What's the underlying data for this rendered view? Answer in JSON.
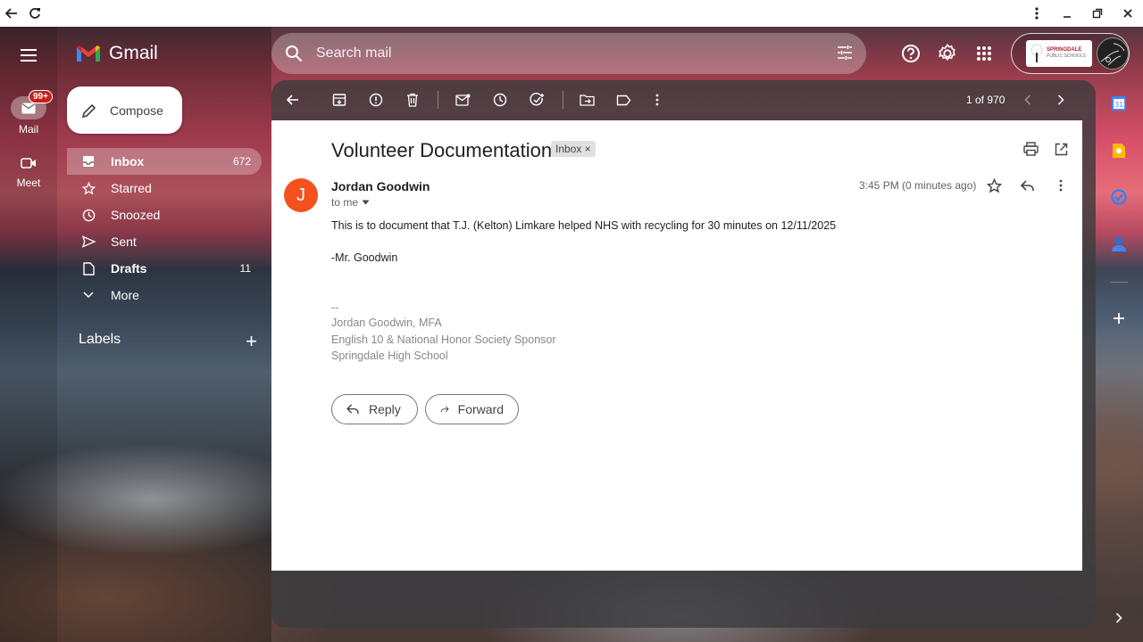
{
  "app": {
    "name": "Gmail"
  },
  "rail": {
    "mail_label": "Mail",
    "mail_badge": "99+",
    "meet_label": "Meet"
  },
  "sidebar": {
    "compose_label": "Compose",
    "items": [
      {
        "label": "Inbox",
        "count": "672",
        "icon": "inbox-icon"
      },
      {
        "label": "Starred",
        "count": "",
        "icon": "star-icon"
      },
      {
        "label": "Snoozed",
        "count": "",
        "icon": "clock-icon"
      },
      {
        "label": "Sent",
        "count": "",
        "icon": "send-icon"
      },
      {
        "label": "Drafts",
        "count": "11",
        "icon": "draft-icon"
      },
      {
        "label": "More",
        "count": "",
        "icon": "chevron-down-icon"
      }
    ],
    "labels_title": "Labels"
  },
  "search": {
    "placeholder": "Search mail"
  },
  "account": {
    "org_line1": "SPRINGDALE",
    "org_line2": "PUBLIC SCHOOLS"
  },
  "toolbar": {
    "pager": "1 of 970"
  },
  "email": {
    "subject": "Volunteer Documentation",
    "label_chip": "Inbox ×",
    "sender_initial": "J",
    "sender_name": "Jordan Goodwin",
    "recipient": "to me",
    "timestamp": "3:45 PM (0 minutes ago)",
    "body_line1": "This is to document that T.J. (Kelton) Limkare helped NHS with recycling for 30 minutes on 12/11/2025",
    "body_line2": "-Mr. Goodwin",
    "sig_sep": "--",
    "sig_name": "Jordan Goodwin, MFA",
    "sig_title": "English 10 & National Honor Society Sponsor",
    "sig_school": "Springdale High School",
    "reply_label": "Reply",
    "forward_label": "Forward"
  }
}
